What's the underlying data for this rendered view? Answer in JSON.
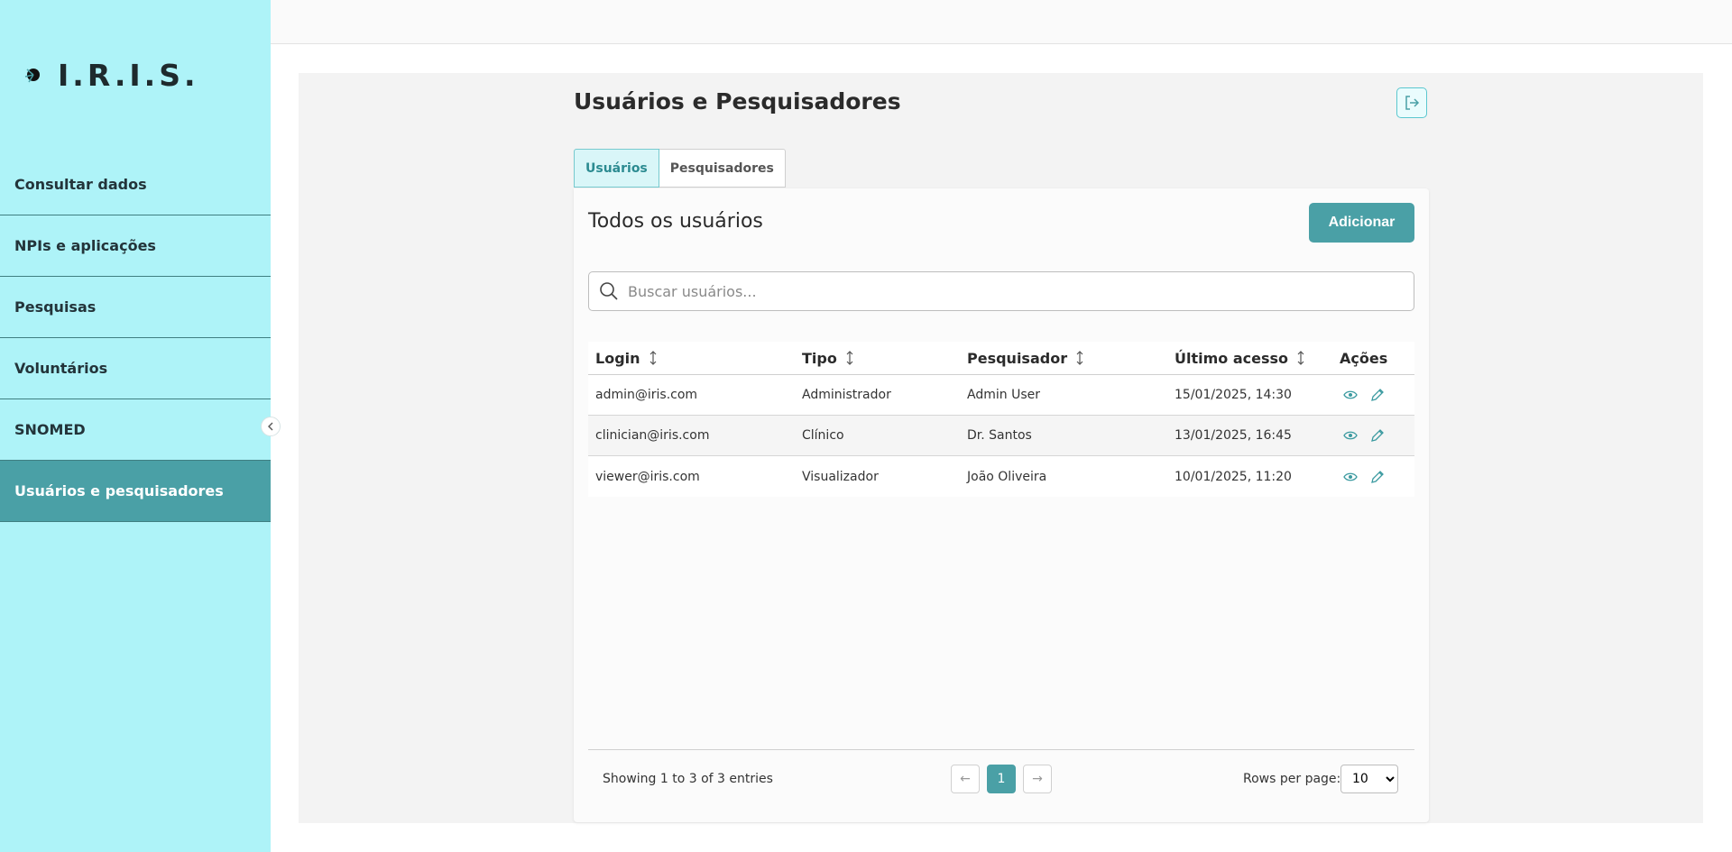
{
  "app": {
    "logo_text": "I.R.I.S."
  },
  "sidebar": {
    "items": [
      {
        "label": "Consultar dados"
      },
      {
        "label": "NPIs e aplicações"
      },
      {
        "label": "Pesquisas"
      },
      {
        "label": "Voluntários"
      },
      {
        "label": "SNOMED"
      },
      {
        "label": "Usuários e pesquisadores",
        "active": true
      }
    ],
    "collapse_icon": "chevron-left-icon"
  },
  "page": {
    "title": "Usuários e Pesquisadores",
    "logout_icon": "logout-icon"
  },
  "tabs": [
    {
      "label": "Usuários",
      "active": true
    },
    {
      "label": "Pesquisadores",
      "active": false
    }
  ],
  "card": {
    "title": "Todos os usuários",
    "add_label": "Adicionar"
  },
  "search": {
    "placeholder": "Buscar usuários..."
  },
  "table": {
    "columns": [
      "Login",
      "Tipo",
      "Pesquisador",
      "Último acesso",
      "Ações"
    ],
    "rows": [
      {
        "login": "admin@iris.com",
        "tipo": "Administrador",
        "pesquisador": "Admin User",
        "ultimo_acesso": "15/01/2025, 14:30"
      },
      {
        "login": "clinician@iris.com",
        "tipo": "Clínico",
        "pesquisador": "Dr. Santos",
        "ultimo_acesso": "13/01/2025, 16:45"
      },
      {
        "login": "viewer@iris.com",
        "tipo": "Visualizador",
        "pesquisador": "João Oliveira",
        "ultimo_acesso": "10/01/2025, 11:20"
      }
    ]
  },
  "pagination": {
    "showing": "Showing 1 to 3 of 3 entries",
    "prev": "←",
    "current_page": "1",
    "next": "→",
    "rows_per_page_label": "Rows per page:",
    "rows_per_page_value": "10"
  },
  "colors": {
    "sidebar_bg": "#aef3f8",
    "accent": "#4aa0a6",
    "active_tab_bg": "#d9f6f8"
  }
}
